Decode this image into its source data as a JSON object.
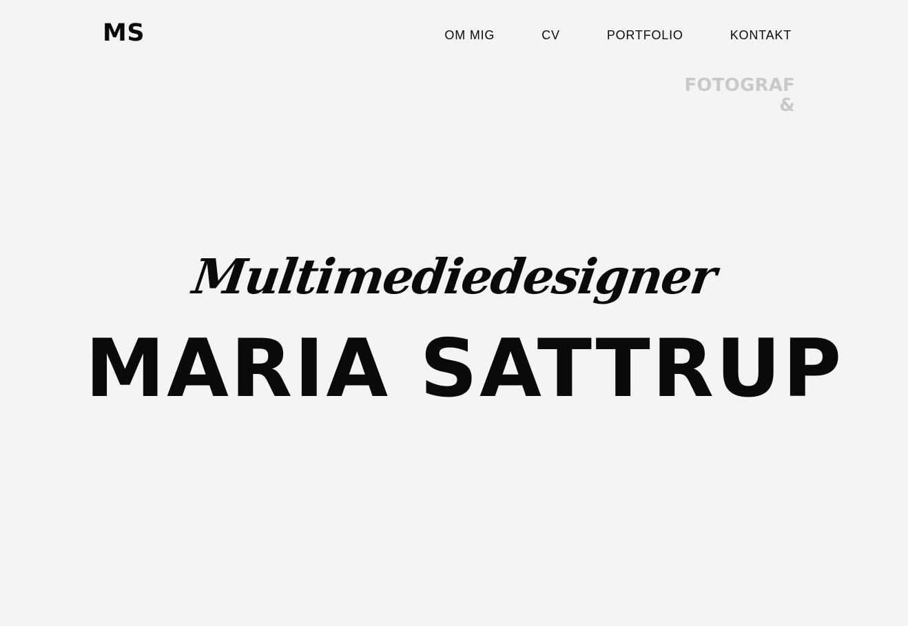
{
  "logo": {
    "text": "MS"
  },
  "nav": {
    "items": [
      {
        "label": "OM MIG"
      },
      {
        "label": "CV"
      },
      {
        "label": "PORTFOLIO"
      },
      {
        "label": "KONTAKT"
      }
    ]
  },
  "tagline": {
    "line1": "FOTOGRAF",
    "line2": "&"
  },
  "hero": {
    "script_title": "Multimediedesigner",
    "name": "MARIA SATTRUP"
  },
  "colors": {
    "background": "#f4f4f3",
    "text": "#0a0a0a",
    "tagline": "#c9c9c9"
  }
}
